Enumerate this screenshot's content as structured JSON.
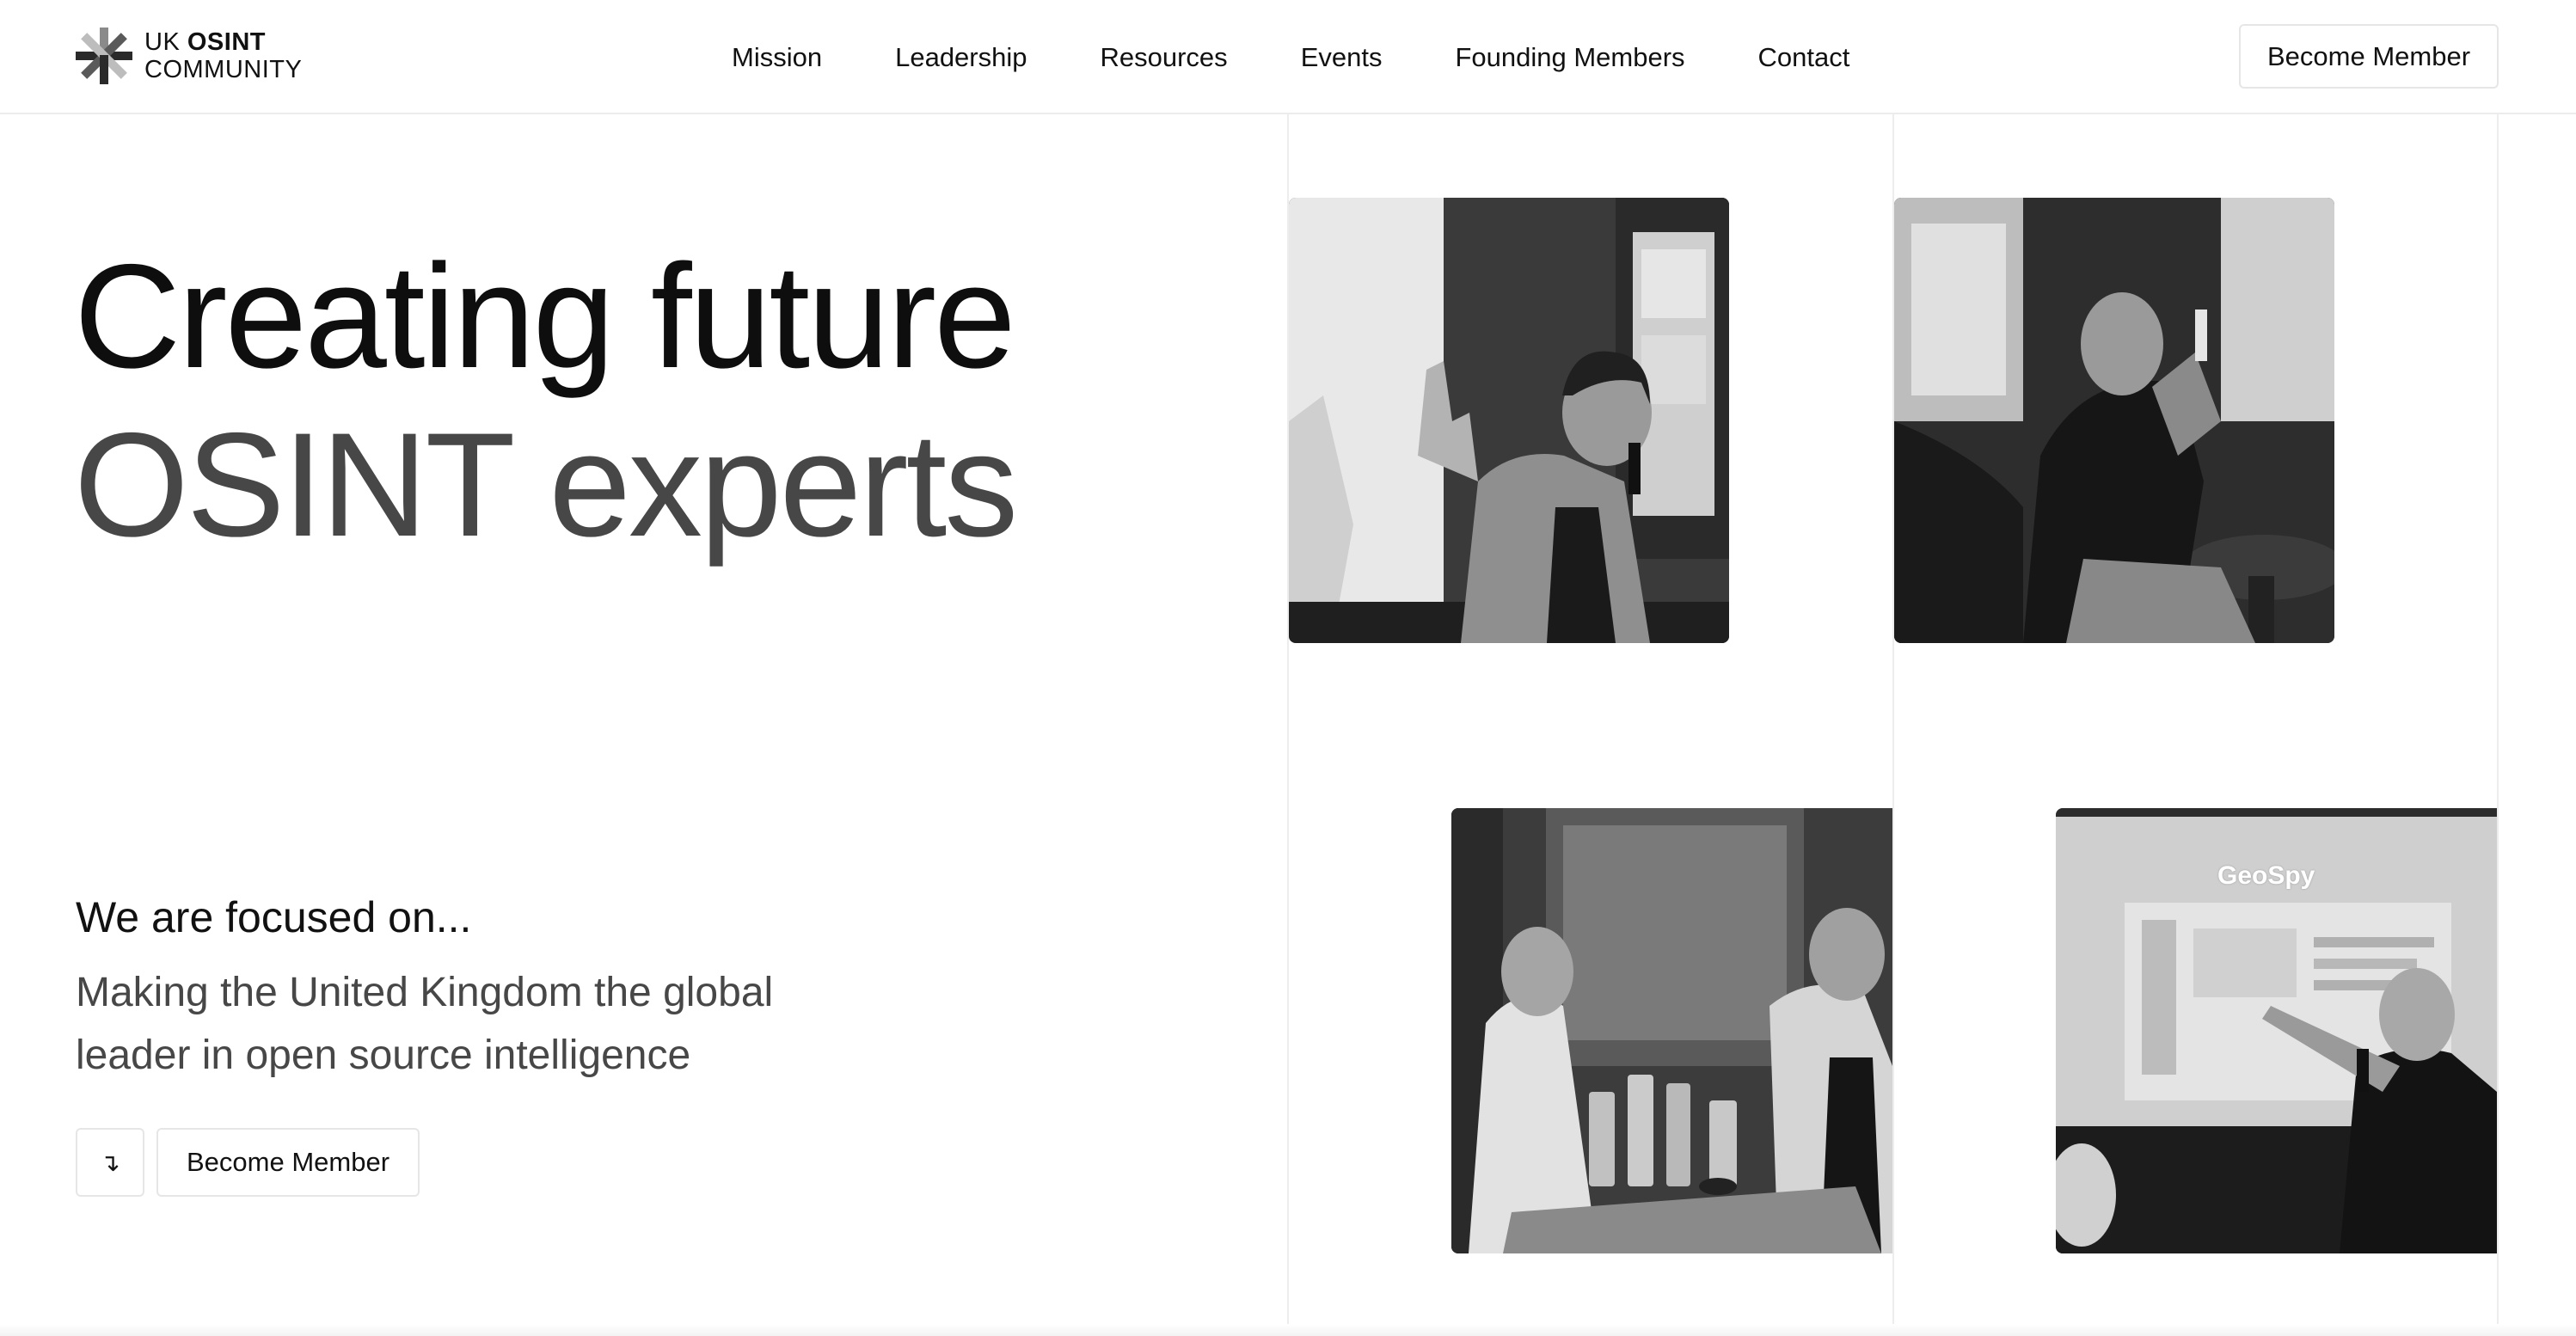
{
  "header": {
    "logo": {
      "line1_light": "UK",
      "line1_bold": "OSINT",
      "line2": "COMMUNITY"
    },
    "nav": [
      "Mission",
      "Leadership",
      "Resources",
      "Events",
      "Founding Members",
      "Contact"
    ],
    "cta_label": "Become Member"
  },
  "hero": {
    "title_line1": "Creating future",
    "title_line2": "OSINT experts",
    "focus_label": "We are focused on...",
    "focus_text": "Making the United Kingdom the global leader in open source intelligence",
    "arrow_glyph": "↴",
    "cta_label": "Become Member"
  },
  "photos": {
    "screen_title": "GeoSpy"
  },
  "colors": {
    "text": "#111111",
    "muted_text": "#474747",
    "border": "#e6e6e6",
    "background": "#ffffff"
  }
}
